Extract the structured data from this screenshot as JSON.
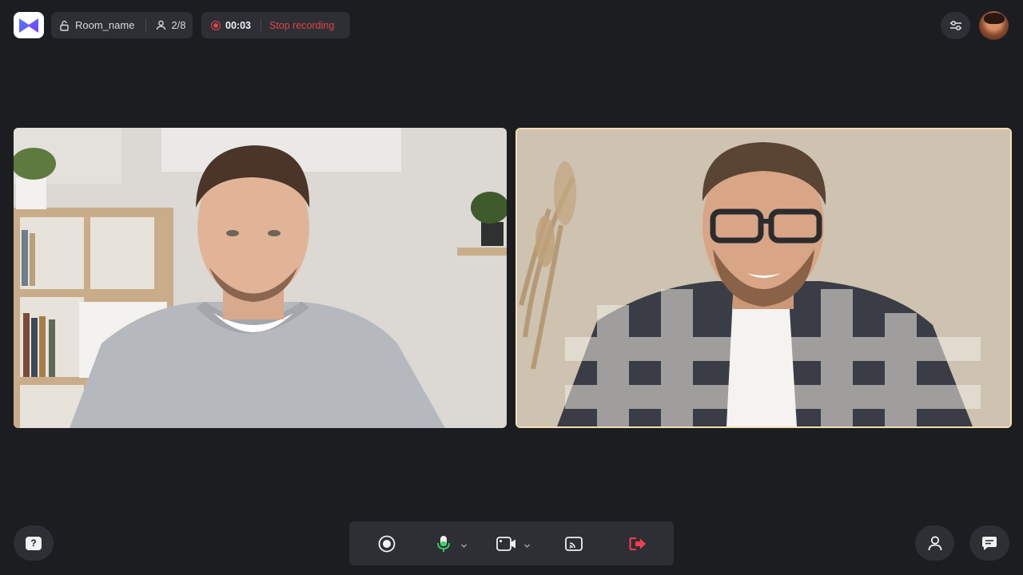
{
  "app": {
    "logo": "meeting-logo-icon"
  },
  "room": {
    "name": "Room_name",
    "participants": "2/8",
    "lock_icon": "unlock-icon",
    "participants_icon": "user-icon"
  },
  "recording": {
    "time": "00:03",
    "stop_label": "Stop recording",
    "color": "#e0434b"
  },
  "header_actions": {
    "settings_icon": "sliders-icon",
    "avatar": "user-avatar"
  },
  "tiles": [
    {
      "id": "participant-1",
      "active": false
    },
    {
      "id": "participant-2",
      "active": true,
      "highlight_color": "#f2dfb4"
    }
  ],
  "controls": {
    "record_icon": "record-icon",
    "mic_icon": "microphone-icon",
    "mic_color": "#3fd26b",
    "camera_icon": "camera-icon",
    "screenshare_icon": "cast-icon",
    "leave_icon": "leave-icon",
    "leave_color": "#ff3b4e"
  },
  "bottom": {
    "help_label": "?",
    "people_icon": "people-icon",
    "chat_icon": "chat-icon"
  }
}
